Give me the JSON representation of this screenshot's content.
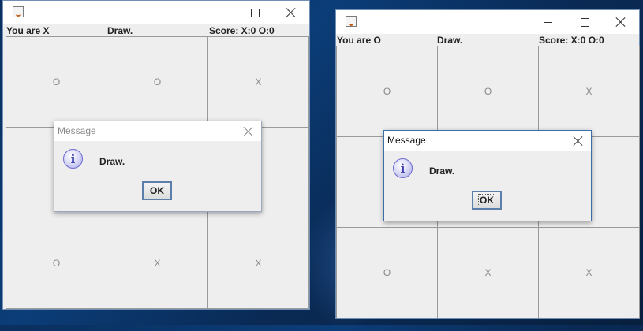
{
  "windows": [
    {
      "status": {
        "role": "You are X",
        "message": "Draw.",
        "score": "Score: X:0 O:0"
      },
      "board": [
        "O",
        "O",
        "X",
        "",
        "",
        "",
        "O",
        "X",
        "X"
      ],
      "dialog": {
        "title": "Message",
        "message": "Draw.",
        "ok_label": "OK"
      }
    },
    {
      "status": {
        "role": "You are O",
        "message": "Draw.",
        "score": "Score: X:0 O:0"
      },
      "board": [
        "O",
        "O",
        "X",
        "",
        "",
        "",
        "O",
        "X",
        "X"
      ],
      "dialog": {
        "title": "Message",
        "message": "Draw.",
        "ok_label": "OK"
      }
    }
  ],
  "icons": {
    "app": "java-icon",
    "minimize": "minimize-icon",
    "maximize": "maximize-icon",
    "close": "close-icon",
    "info": "info-icon"
  },
  "colors": {
    "desktop": "#0b3d78",
    "window_bg": "#eeeeee",
    "grid_line": "#9a9a9a"
  }
}
